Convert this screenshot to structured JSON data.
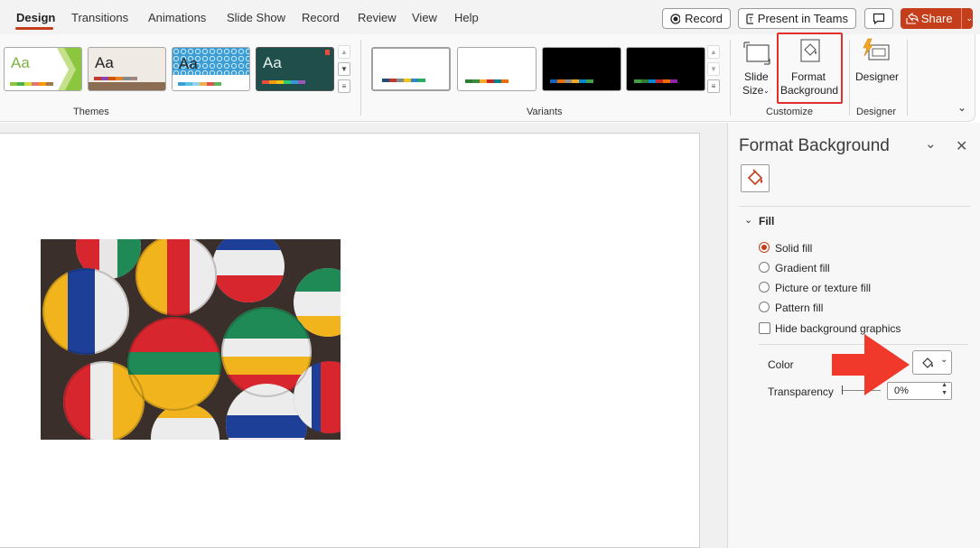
{
  "tabs": [
    {
      "label": "Design",
      "active": true
    },
    {
      "label": "Transitions"
    },
    {
      "label": "Animations"
    },
    {
      "label": "Slide Show"
    },
    {
      "label": "Record"
    },
    {
      "label": "Review"
    },
    {
      "label": "View"
    },
    {
      "label": "Help"
    }
  ],
  "topbar": {
    "record_label": "Record",
    "present_label": "Present in Teams",
    "share_label": "Share"
  },
  "ribbon": {
    "themes_label": "Themes",
    "variants_label": "Variants",
    "customize_label": "Customize",
    "designer_group_label": "Designer",
    "slide_size_line1": "Slide",
    "slide_size_line2": "Size",
    "format_bg_line1": "Format",
    "format_bg_line2": "Background",
    "designer_label": "Designer",
    "theme_glyph": "Aa"
  },
  "pane": {
    "title": "Format Background",
    "fill_section": "Fill",
    "options": [
      {
        "label": "Solid fill",
        "selected": true
      },
      {
        "label": "Gradient fill",
        "selected": false
      },
      {
        "label": "Picture or texture fill",
        "selected": false
      },
      {
        "label": "Pattern fill",
        "selected": false
      }
    ],
    "hide_graphics_label": "Hide background graphics",
    "color_label": "Color",
    "transparency_label": "Transparency",
    "transparency_value": "0%"
  },
  "colors": {
    "accent": "#c43e1c",
    "arrow": "#f0392b"
  }
}
